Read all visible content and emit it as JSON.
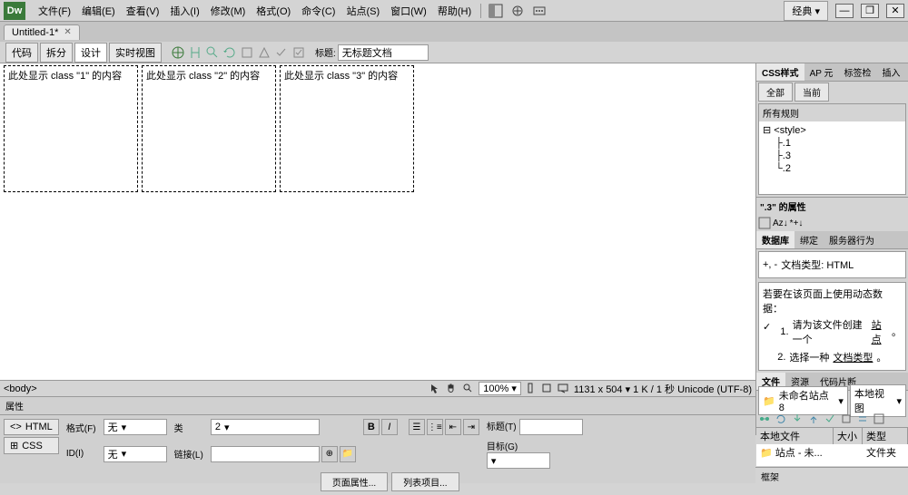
{
  "app": {
    "logo": "Dw",
    "workspace": "经典"
  },
  "menu": [
    "文件(F)",
    "编辑(E)",
    "查看(V)",
    "插入(I)",
    "修改(M)",
    "格式(O)",
    "命令(C)",
    "站点(S)",
    "窗口(W)",
    "帮助(H)"
  ],
  "doc_tab": "Untitled-1*",
  "view": {
    "buttons": [
      "代码",
      "拆分",
      "设计",
      "实时视图"
    ],
    "active": 2,
    "title_label": "标题:",
    "title_value": "无标题文档"
  },
  "boxes": [
    "此处显示 class \"1\" 的内容",
    "此处显示 class \"2\" 的内容",
    "此处显示 class \"3\" 的内容"
  ],
  "css_panel": {
    "tabs": [
      "CSS样式",
      "AP 元",
      "标签检",
      "插入"
    ],
    "sub": [
      "全部",
      "当前"
    ],
    "rules_label": "所有规则",
    "tree_root": "<style>",
    "tree_items": [
      ".1",
      ".3",
      ".2"
    ],
    "props_label": "\".3\" 的属性"
  },
  "db_panel": {
    "tabs": [
      "数据库",
      "绑定",
      "服务器行为"
    ],
    "doc_type": "文档类型: HTML",
    "hint_title": "若要在该页面上使用动态数据：",
    "hints": [
      {
        "n": "1.",
        "pre": "请为该文件创建一个",
        "link": "站点",
        "post": "。"
      },
      {
        "n": "2.",
        "pre": "选择一种",
        "link": "文档类型",
        "post": "。"
      }
    ]
  },
  "files_panel": {
    "tabs": [
      "文件",
      "资源",
      "代码片断"
    ],
    "site": "未命名站点 8",
    "view_mode": "本地视图",
    "cols": [
      "本地文件",
      "大小",
      "类型"
    ],
    "row": {
      "name": "站点 - 未...",
      "type": "文件夹"
    }
  },
  "status": {
    "tag": "<body>",
    "zoom": "100%",
    "info": "1131 x 504 ▾ 1 K / 1 秒 Unicode (UTF-8)"
  },
  "props": {
    "title": "属性",
    "modes": [
      {
        "icon": "<>",
        "label": "HTML"
      },
      {
        "icon": "⊞",
        "label": "CSS"
      }
    ],
    "format_label": "格式(F)",
    "format_value": "无",
    "id_label": "ID(I)",
    "id_value": "无",
    "class_label": "类",
    "class_value": "2",
    "link_label": "链接(L)",
    "link_value": "",
    "title2_label": "标题(T)",
    "target_label": "目标(G)",
    "page_btns": [
      "页面属性...",
      "列表项目..."
    ]
  },
  "frame": "框架"
}
